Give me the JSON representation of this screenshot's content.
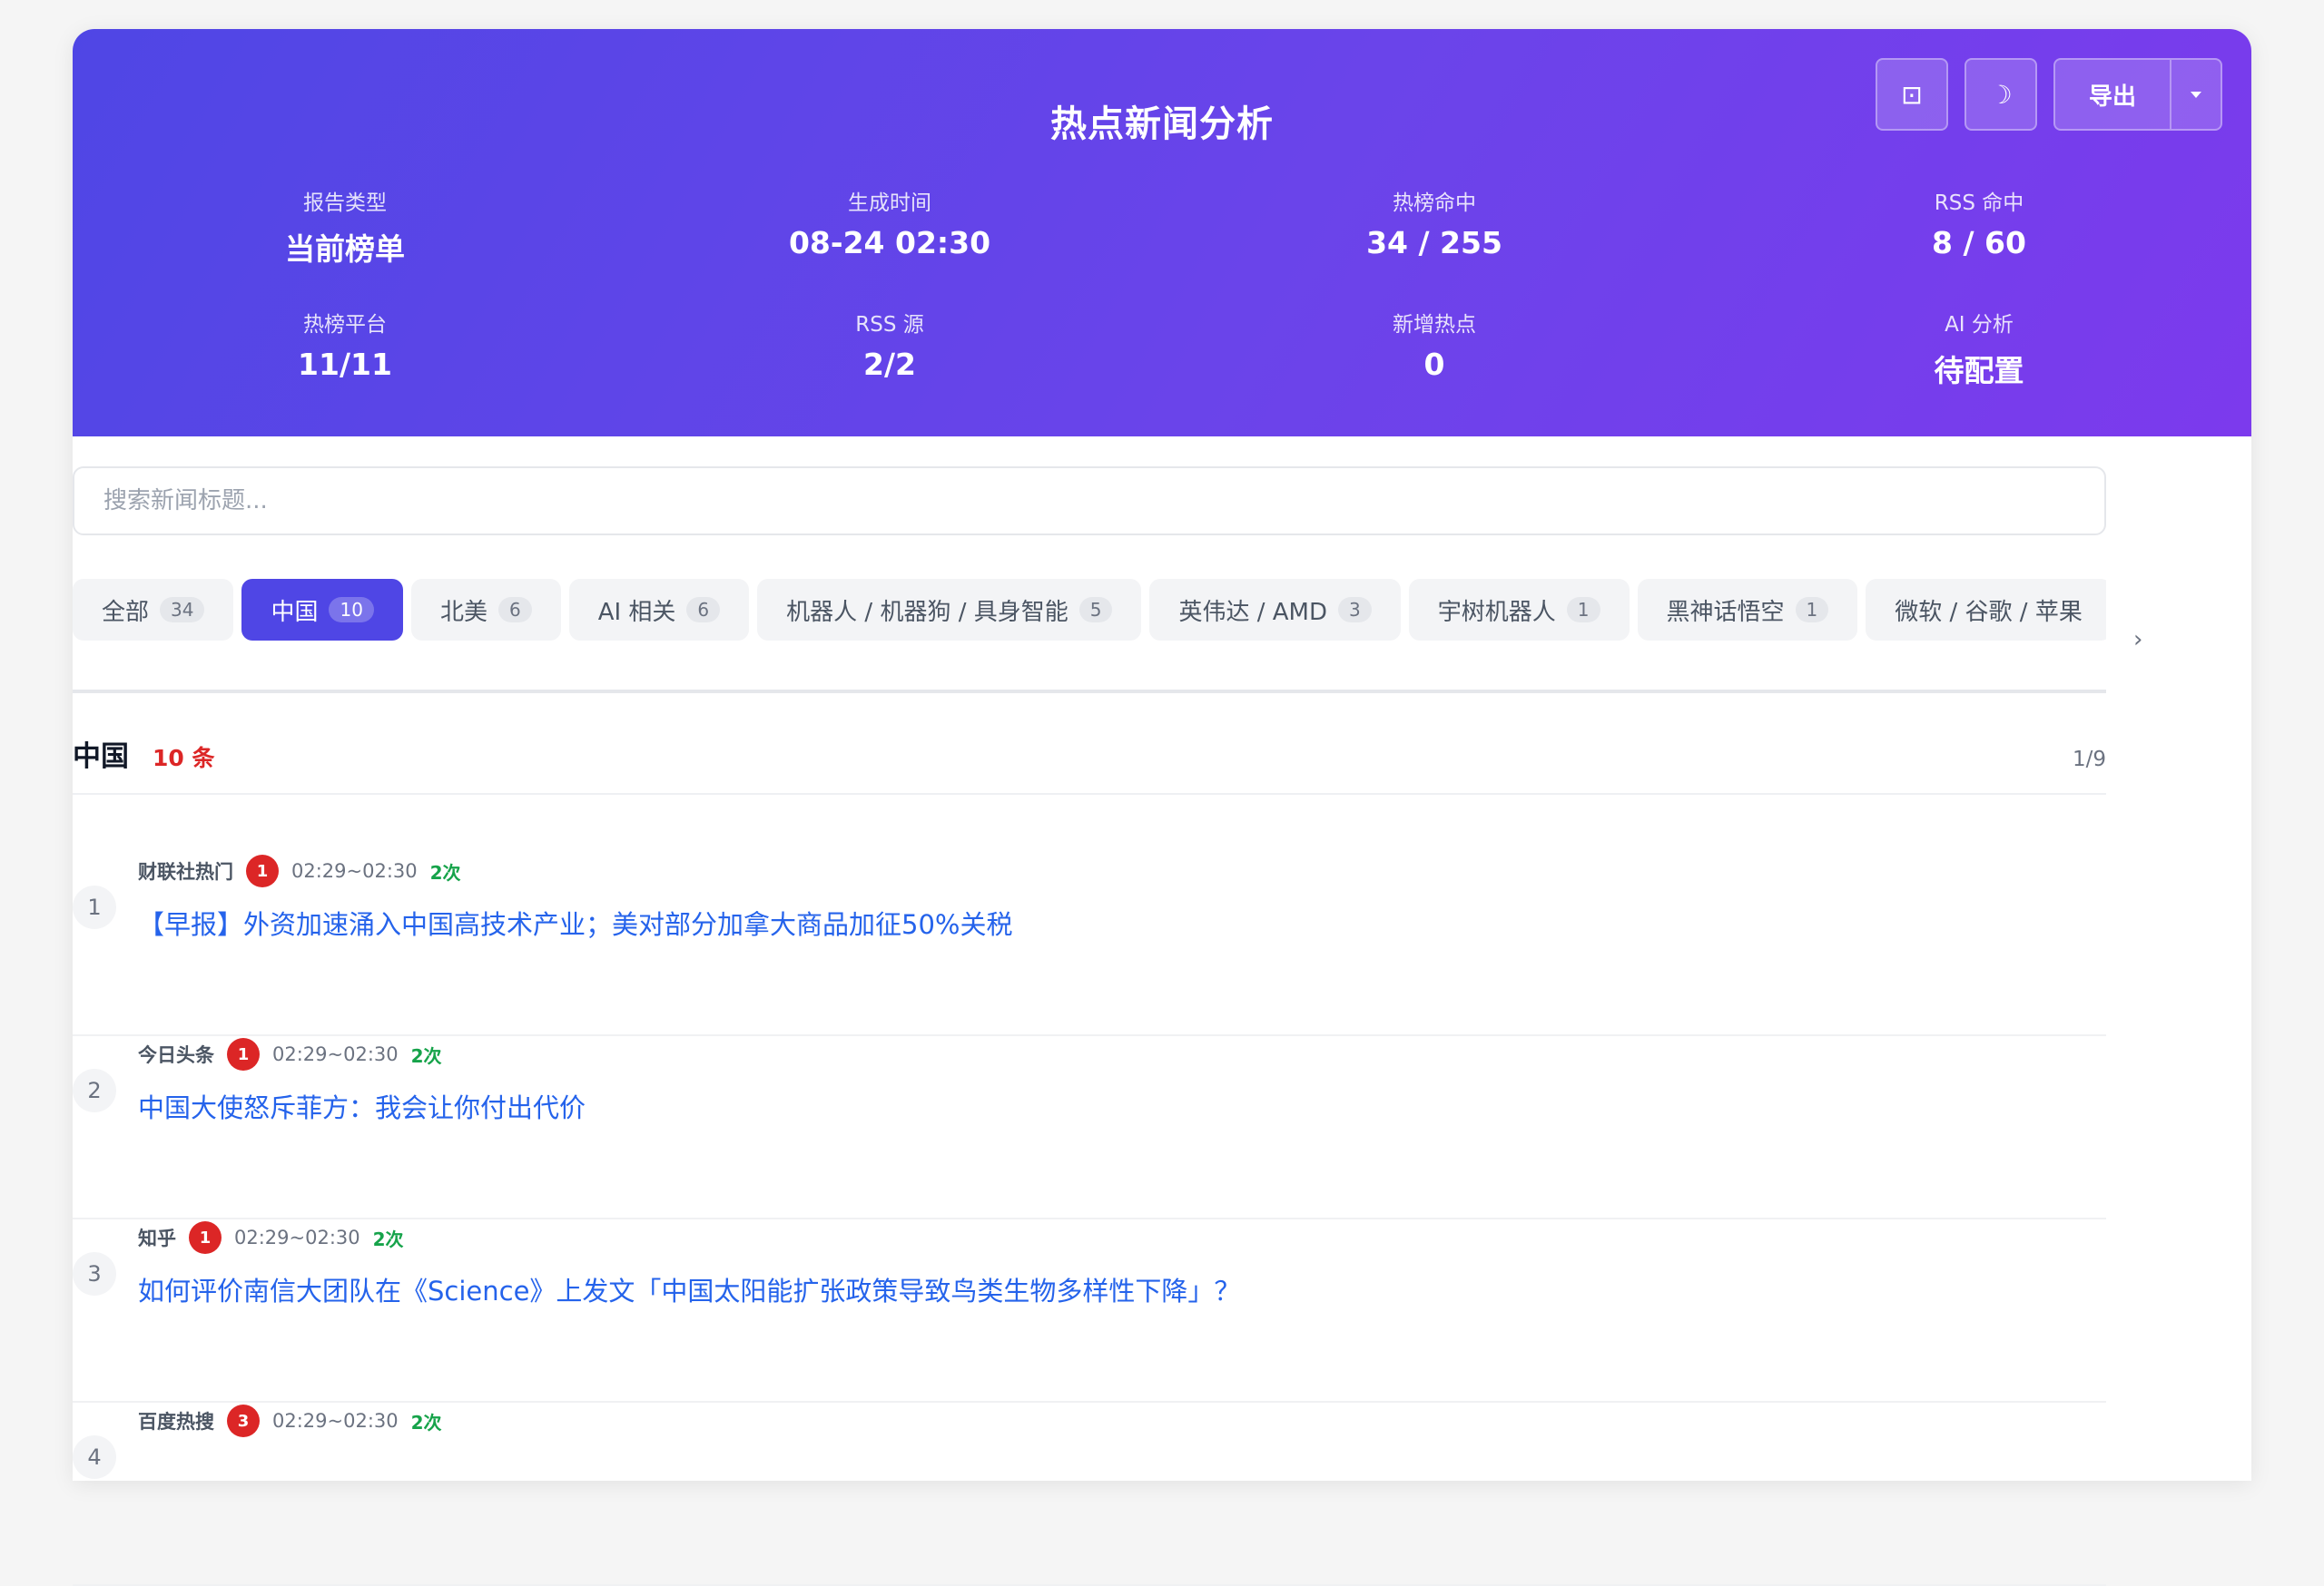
{
  "header": {
    "title": "热点新闻分析",
    "actions": {
      "screenshot_icon": "⊡",
      "theme_icon": "☽",
      "export_label": "导出"
    },
    "stats": [
      {
        "label": "报告类型",
        "value": "当前榜单"
      },
      {
        "label": "生成时间",
        "value": "08-24 02:30"
      },
      {
        "label": "热榜命中",
        "value": "34 / 255"
      },
      {
        "label": "RSS 命中",
        "value": "8 / 60"
      },
      {
        "label": "热榜平台",
        "value": "11/11"
      },
      {
        "label": "RSS 源",
        "value": "2/2"
      },
      {
        "label": "新增热点",
        "value": "0"
      },
      {
        "label": "AI 分析",
        "value": "待配置"
      }
    ]
  },
  "search": {
    "placeholder": "搜索新闻标题..."
  },
  "tabs": [
    {
      "label": "全部",
      "count": "34"
    },
    {
      "label": "中国",
      "count": "10"
    },
    {
      "label": "北美",
      "count": "6"
    },
    {
      "label": "AI 相关",
      "count": "6"
    },
    {
      "label": "机器人 / 机器狗 / 具身智能",
      "count": "5"
    },
    {
      "label": "英伟达 / AMD",
      "count": "3"
    },
    {
      "label": "宇树机器人",
      "count": "1"
    },
    {
      "label": "黑神话悟空",
      "count": "1"
    },
    {
      "label": "微软 / 谷歌 / 苹果",
      "count": ""
    }
  ],
  "tabs_arrow": "›",
  "active_tab_index": 1,
  "section": {
    "title": "中国",
    "count": "10 条",
    "page": "1/9"
  },
  "news": [
    {
      "rank": "1",
      "source": "财联社热门",
      "badge": "1",
      "time": "02:29~02:30",
      "times": "2次",
      "title": "【早报】外资加速涌入中国高技术产业；美对部分加拿大商品加征50%关税"
    },
    {
      "rank": "2",
      "source": "今日头条",
      "badge": "1",
      "time": "02:29~02:30",
      "times": "2次",
      "title": "中国大使怒斥菲方：我会让你付出代价"
    },
    {
      "rank": "3",
      "source": "知乎",
      "badge": "1",
      "time": "02:29~02:30",
      "times": "2次",
      "title": "如何评价南信大团队在《Science》上发文「中国太阳能扩张政策导致鸟类生物多样性下降」？"
    },
    {
      "rank": "4",
      "source": "百度热搜",
      "badge": "3",
      "time": "02:29~02:30",
      "times": "2次",
      "title": ""
    }
  ],
  "colors": {
    "accent": "#4f46e5",
    "gradient_end": "#7c3aed",
    "link": "#2563eb",
    "badge": "#dc2626",
    "times": "#16a34a"
  }
}
